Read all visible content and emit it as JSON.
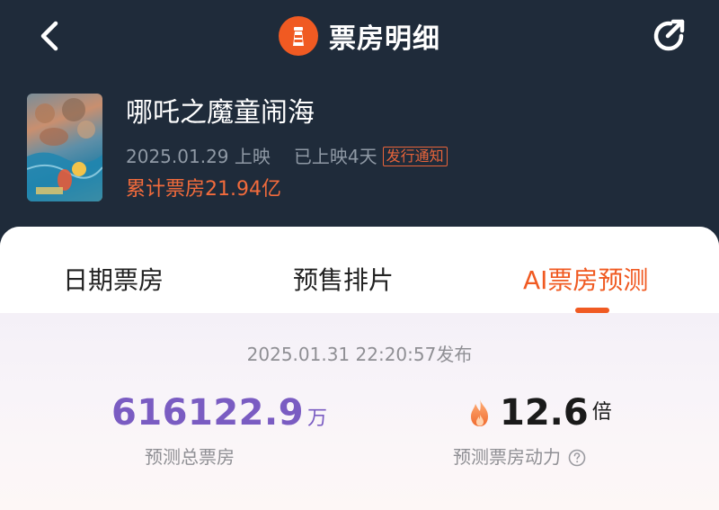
{
  "nav": {
    "title": "票房明细"
  },
  "movie": {
    "title": "哪吒之魔童闹海",
    "release_date": "2025.01.29 上映",
    "days_showing": "已上映4天",
    "badge": "发行通知",
    "total_box_office": "累计票房21.94亿"
  },
  "tabs": [
    {
      "label": "日期票房",
      "active": false
    },
    {
      "label": "预售排片",
      "active": false
    },
    {
      "label": "AI票房预测",
      "active": true
    }
  ],
  "prediction": {
    "publish_time": "2025.01.31 22:20:57发布",
    "total_value": "616122.9",
    "total_unit": "万",
    "total_label": "预测总票房",
    "multiple_value": "12.6",
    "multiple_unit": "倍",
    "multiple_label": "预测票房动力"
  },
  "icons": {
    "back": "chevron-left-icon",
    "logo": "lighthouse-logo-icon",
    "share": "share-icon",
    "fire": "fire-icon",
    "help": "question-circle-icon"
  },
  "colors": {
    "header_bg": "#1f2b3a",
    "accent": "#f05a22",
    "predict_purple": "#7a5cc2",
    "muted": "#8f99a5"
  }
}
